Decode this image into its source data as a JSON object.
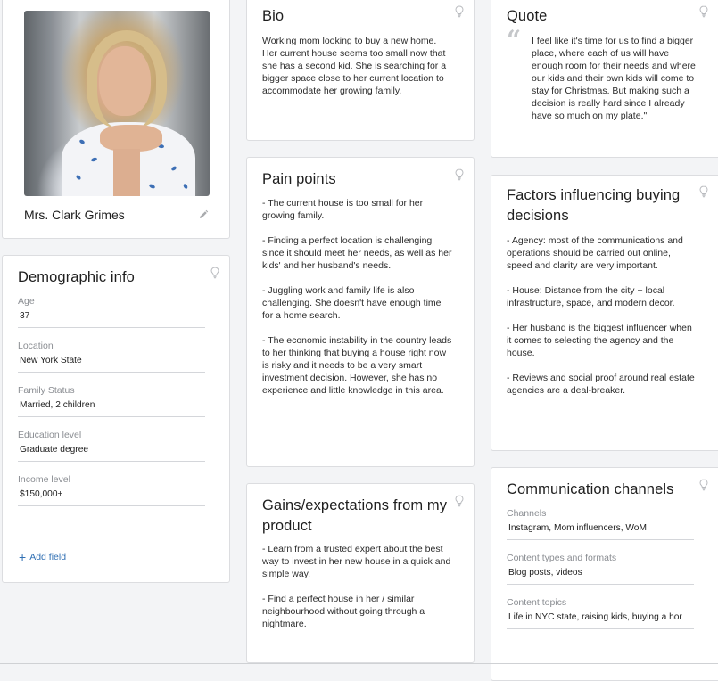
{
  "profile": {
    "name": "Mrs. Clark Grimes",
    "photo_alt": "Portrait of a blonde woman in a white patterned blouse, chin resting on hands",
    "edit_icon": "pencil-icon"
  },
  "demographic": {
    "title": "Demographic info",
    "fields": [
      {
        "label": "Age",
        "value": "37"
      },
      {
        "label": "Location",
        "value": "New York State"
      },
      {
        "label": "Family Status",
        "value": "Married, 2 children"
      },
      {
        "label": "Education level",
        "value": "Graduate degree"
      },
      {
        "label": "Income level",
        "value": "$150,000+"
      }
    ],
    "add_field_label": "Add field",
    "add_icon": "plus-icon"
  },
  "bio": {
    "title": "Bio",
    "text": "Working mom looking to buy a new home. Her current house seems too small now that she has a second kid. She is searching for a bigger space close to her current location to accommodate her growing family."
  },
  "pain_points": {
    "title": "Pain points",
    "text": "- The current house is too small for her growing family.\n\n- Finding a perfect location is challenging since it should meet her needs, as well as her kids' and her husband's needs.\n\n- Juggling work and family life is also challenging. She doesn't have enough time for a home search.\n\n- The economic instability in the country leads to her thinking that buying a house right now is risky and it needs to be a very smart investment decision. However, she has no experience and little knowledge in this area."
  },
  "gains": {
    "title": "Gains/expectations from my product",
    "text": "- Learn from a trusted expert about the best way to invest in her new house in a quick and simple way.\n\n- Find a perfect house in her / similar neighbourhood without going through a nightmare."
  },
  "quote": {
    "title": "Quote",
    "mark": "“",
    "text": "I feel like it's time for us to find a bigger place, where each of us will have enough room for their needs and where our kids and their own kids will come to stay for Christmas. But making such a decision is really hard since I already have so much on my plate.\""
  },
  "factors": {
    "title": "Factors influencing buying decisions",
    "text": "- Agency: most of the communications and operations should be carried out online, speed and clarity are very important.\n\n- House: Distance from the city + local infrastructure, space, and modern decor.\n\n- Her husband is the biggest influencer when it comes to selecting the agency and the house.\n\n- Reviews and social proof around real estate agencies are a deal-breaker."
  },
  "communication": {
    "title": "Communication channels",
    "fields": [
      {
        "label": "Channels",
        "value": "Instagram, Mom influencers, WoM"
      },
      {
        "label": "Content types and formats",
        "value": "Blog posts, videos"
      },
      {
        "label": "Content topics",
        "value": "Life in NYC state, raising kids, buying a hor"
      }
    ]
  },
  "icons": {
    "hint": "lightbulb-icon"
  },
  "colors": {
    "background": "#f3f4f6",
    "card": "#ffffff",
    "border": "#dcdde0",
    "accent_link": "#2f6fb3",
    "muted_label": "#8a8d92",
    "icon_gray": "#b9bbbf"
  }
}
